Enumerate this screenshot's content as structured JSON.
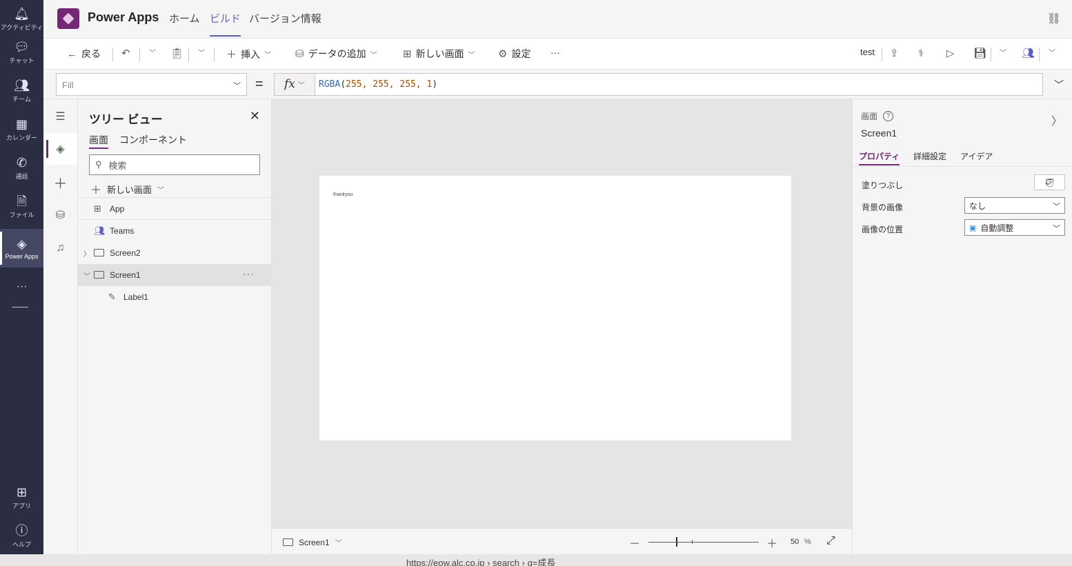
{
  "rail": {
    "items": [
      {
        "label": "アクティビティ",
        "icon": "bell-icon"
      },
      {
        "label": "チャット",
        "icon": "chat-icon"
      },
      {
        "label": "チーム",
        "icon": "teams-icon"
      },
      {
        "label": "カレンダー",
        "icon": "calendar-icon"
      },
      {
        "label": "通話",
        "icon": "phone-icon"
      },
      {
        "label": "ファイル",
        "icon": "file-icon"
      },
      {
        "label": "Power Apps",
        "icon": "power-apps-icon"
      }
    ],
    "more": "···",
    "bottom_items": [
      {
        "label": "アプリ",
        "icon": "apps-icon"
      },
      {
        "label": "ヘルプ",
        "icon": "help-icon"
      }
    ]
  },
  "header": {
    "app_title": "Power Apps",
    "tabs": [
      {
        "label": "ホーム"
      },
      {
        "label": "ビルド",
        "active": true
      },
      {
        "label": "バージョン情報"
      }
    ]
  },
  "toolbar": {
    "back": "戻る",
    "insert": "挿入",
    "add_data": "データの追加",
    "new_screen": "新しい画面",
    "settings": "設定",
    "more": "···",
    "app_name": "test"
  },
  "formula_bar": {
    "property": "Fill",
    "equals": "=",
    "fx": "fx",
    "formula_fn": "RGBA",
    "formula_args": "255, 255, 255, 1"
  },
  "tree_view": {
    "title": "ツリー ビュー",
    "tabs": [
      "画面",
      "コンポーネント"
    ],
    "search_placeholder": "検索",
    "new_screen": "新しい画面",
    "items": [
      {
        "label": "App"
      },
      {
        "label": "Teams"
      },
      {
        "label": "Screen2"
      },
      {
        "label": "Screen1",
        "selected": true
      },
      {
        "label": "Label1"
      }
    ]
  },
  "canvas": {
    "label_text": "thankyou"
  },
  "status_bar": {
    "screen": "Screen1",
    "zoom": "50",
    "zoom_unit": "%",
    "zoom_level": 0.25
  },
  "properties": {
    "category": "画面",
    "name": "Screen1",
    "tabs": [
      "プロパティ",
      "詳細設定",
      "アイデア"
    ],
    "fill_label": "塗りつぶし",
    "bg_image_label": "背景の画像",
    "bg_image_value": "なし",
    "image_position_label": "画像の位置",
    "image_position_value": "自動調整"
  },
  "background_url": "https://eow.alc.co.jp › search › q=成長"
}
